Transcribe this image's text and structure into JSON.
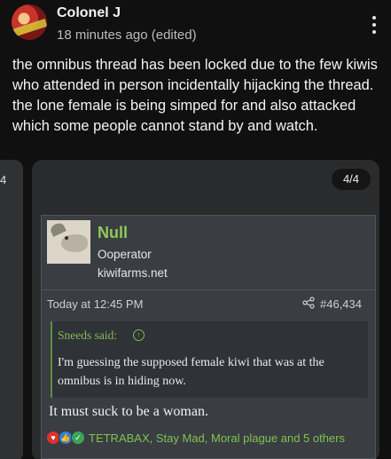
{
  "post": {
    "author": "Colonel J",
    "meta": "18 minutes ago (edited)",
    "body": "the omnibus thread has been locked due to the few kiwis who attended in person incidentally hijacking the thread. the lone female is being simped for and also attacked which some people cannot stand by and watch."
  },
  "carousel": {
    "prev_label": "4",
    "pager": "4/4"
  },
  "embedded": {
    "user": {
      "name": "Null",
      "role": "Ooperator",
      "site": "kiwifarms.net"
    },
    "time": "Today at 12:45 PM",
    "post_number": "#46,434",
    "quote": {
      "attribution": "Sneeds said:",
      "text": "I'm guessing the supposed female kiwi that was at the omnibus is in hiding now."
    },
    "reply": "It must suck to be a woman.",
    "reactions": {
      "summary": "TETRABAX, Stay Mad, Moral plague and 5 others",
      "icons": [
        "heart-icon",
        "thumbs-up-icon",
        "checkmark-icon"
      ],
      "colors": {
        "heart": "#d9342b",
        "thumbs": "#2f7fd8",
        "check": "#3aa657",
        "accent": "#86b858"
      }
    }
  }
}
